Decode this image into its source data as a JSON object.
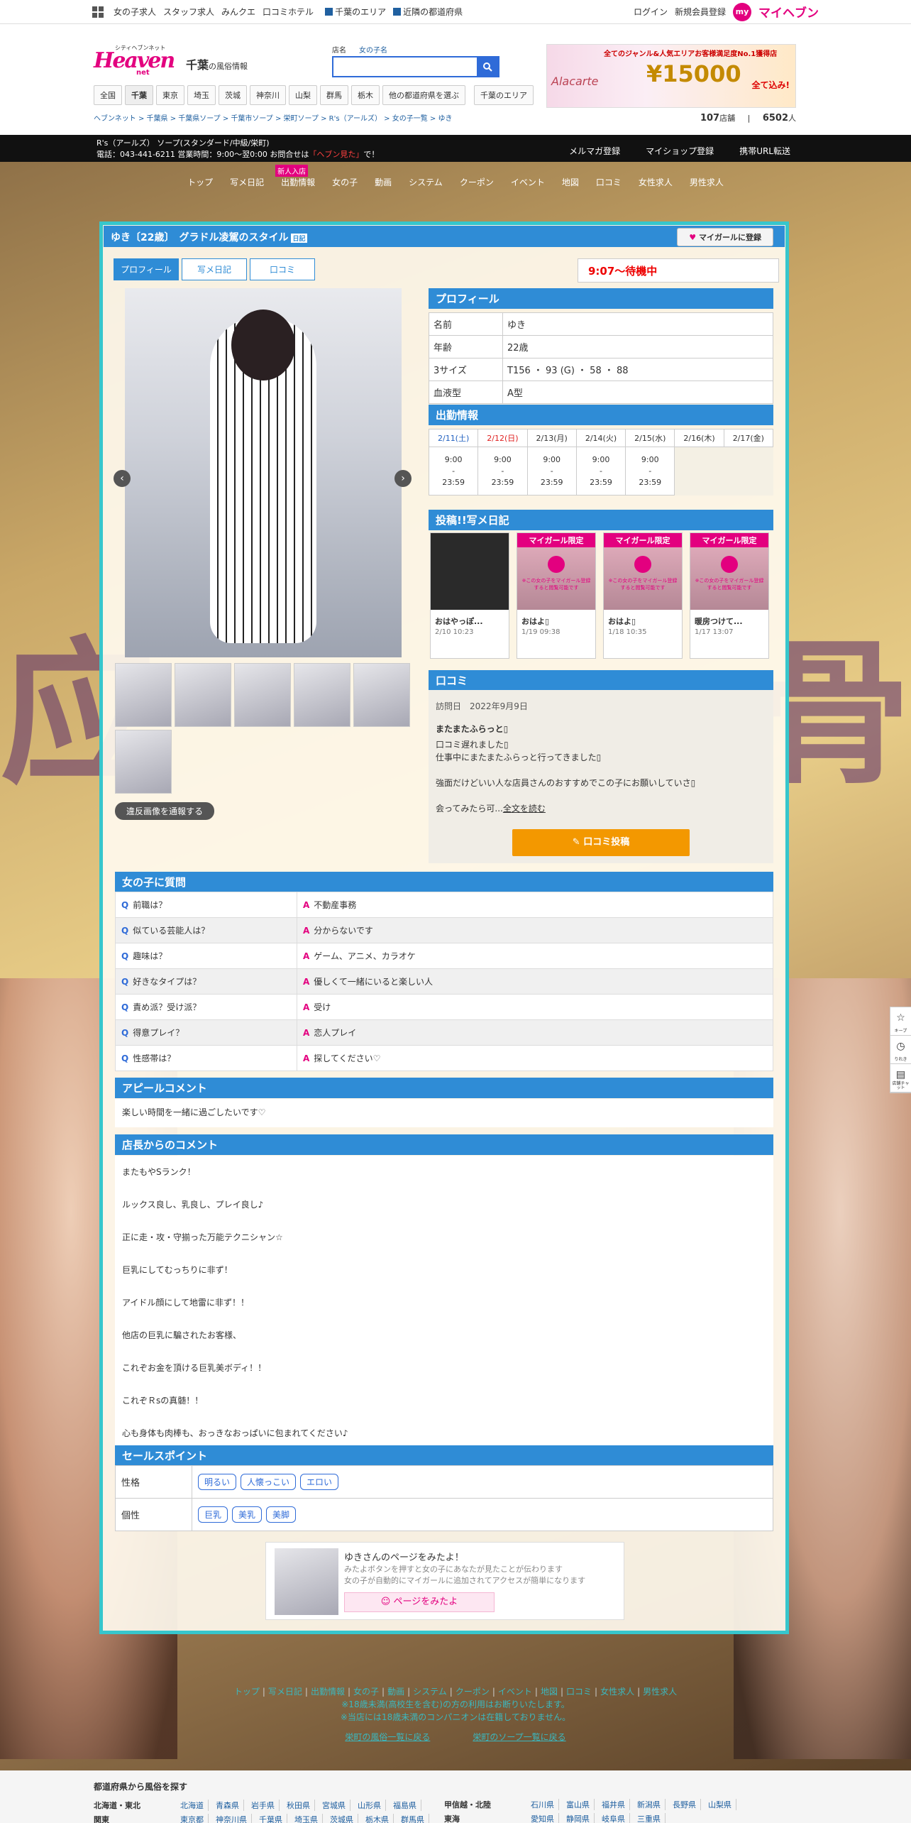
{
  "topbar": {
    "links": [
      "女の子求人",
      "スタッフ求人",
      "みんクエ",
      "口コミホテル"
    ],
    "area_link": "千葉のエリア",
    "near_link": "近隣の都道府県",
    "login": "ログイン",
    "register": "新規会員登録",
    "my_badge": "my",
    "myheaven": "マイヘブン"
  },
  "header": {
    "logo_small": "シティヘブンネット",
    "logo_main": "Heaven",
    "logo_net": "net",
    "area": "千葉",
    "area_suffix": "の風俗情報",
    "search_tabs": [
      "店名",
      "女の子名"
    ],
    "search_placeholder": "",
    "banner": {
      "line1": "全てのジャンル&人気エリアお客様満足度No.1獲得店",
      "brand": "Alacarte",
      "price": "¥15000",
      "tail": "全て込み!"
    }
  },
  "areanav": [
    "全国",
    "千葉",
    "東京",
    "埼玉",
    "茨城",
    "神奈川",
    "山梨",
    "群馬",
    "栃木",
    "他の都道府県を選ぶ",
    "千葉のエリア"
  ],
  "breadcrumb": "ヘブンネット > 千葉県 > 千葉県ソープ > 千葉市ソープ > 栄町ソープ > R's（アールズ） > 女の子一覧 > ゆき",
  "counts": {
    "shops": "107",
    "shops_unit": "店舗",
    "people": "6502",
    "people_unit": "人"
  },
  "shop": {
    "name": "R's（アールズ） ソープ(スタンダード/中級/栄町)",
    "info": "電話：043-441-6211 営業時間：9:00～翌0:00 お問合せは",
    "heaven_msg": "「ヘブン見た」",
    "info_tail": "で！",
    "links": [
      "メルマガ登録",
      "マイショップ登録",
      "携帯URL転送"
    ]
  },
  "shopnav": [
    "トップ",
    "写メ日記",
    "出勤情報",
    "女の子",
    "動画",
    "システム",
    "クーポン",
    "イベント",
    "地図",
    "口コミ",
    "女性求人",
    "男性求人"
  ],
  "shopnav_new": "新人入店",
  "bg_text": [
    "应",
    "骨"
  ],
  "profile_title": "ゆき〔22歳〕　グラドル凌駕のスタイル",
  "profile_badge": "日記",
  "fav_button": "マイガールに登録",
  "tabs": [
    "プロフィール",
    "写メ日記",
    "口コミ"
  ],
  "status": "9:07～待機中",
  "report": "違反画像を通報する",
  "profile": {
    "section": "プロフィール",
    "rows": [
      [
        "名前",
        "ゆき"
      ],
      [
        "年齢",
        "22歳"
      ],
      [
        "3サイズ",
        "T156 ・ 93 (G) ・ 58 ・ 88"
      ],
      [
        "血液型",
        "A型"
      ]
    ]
  },
  "schedule": {
    "section": "出勤情報",
    "days": [
      "2/11(土)",
      "2/12(日)",
      "2/13(月)",
      "2/14(火)",
      "2/15(水)",
      "2/16(木)",
      "2/17(金)"
    ],
    "shifts": [
      [
        "9:00",
        "-",
        "23:59"
      ],
      [
        "9:00",
        "-",
        "23:59"
      ],
      [
        "9:00",
        "-",
        "23:59"
      ],
      [
        "9:00",
        "-",
        "23:59"
      ],
      [
        "9:00",
        "-",
        "23:59"
      ]
    ]
  },
  "diary": {
    "section": "投稿!!写メ日記",
    "items": [
      {
        "title": "おはやっぽ...",
        "date": "2/10 10:23",
        "locked": false
      },
      {
        "title": "おはよ▯",
        "date": "1/19 09:38",
        "locked": true
      },
      {
        "title": "おはよ▯",
        "date": "1/18 10:35",
        "locked": true
      },
      {
        "title": "暖房つけて...",
        "date": "1/17 13:07",
        "locked": true
      }
    ],
    "lock_label": "マイガール限定",
    "lock_text": "※この女の子をマイガール登録すると閲覧可能です"
  },
  "review": {
    "section": "口コミ",
    "date_label": "訪問日",
    "date": "2022年9月9日",
    "title": "またまたふらっと▯",
    "lines": [
      "口コミ遅れました▯",
      "仕事中にまたまたふらっと行ってきました▯",
      "",
      "強面だけどいい人な店員さんのおすすめでこの子にお願いしていさ▯",
      "",
      "会ってみたら可..."
    ],
    "more": "全文を読む",
    "post_button": "口コミ投稿"
  },
  "qa": {
    "section": "女の子に質問",
    "q_mark": "Q",
    "a_mark": "A",
    "rows": [
      [
        "前職は？",
        "不動産事務"
      ],
      [
        "似ている芸能人は？",
        "分からないです"
      ],
      [
        "趣味は？",
        "ゲーム、アニメ、カラオケ"
      ],
      [
        "好きなタイプは？",
        "優しくて一緒にいると楽しい人"
      ],
      [
        "責め派？受け派？",
        "受け"
      ],
      [
        "得意プレイ？",
        "恋人プレイ"
      ],
      [
        "性感帯は？",
        "探してください♡"
      ]
    ]
  },
  "appeal": {
    "section": "アピールコメント",
    "text": "楽しい時間を一緒に過ごしたいです♡"
  },
  "manager": {
    "section": "店長からのコメント",
    "lines": [
      "またもやSランク！",
      "ルックス良し、乳良し、プレイ良し♪",
      "正に走・攻・守揃った万能テクニシャン☆",
      "巨乳にしてむっちりに非ず！",
      "アイドル顔にして地雷に非ず！！",
      "他店の巨乳に騙されたお客様、",
      "これぞお金を頂ける巨乳美ボディ！！",
      "これぞＲsの真髄！！",
      "心も身体も肉棒も、おっきなおっぱいに包まれてください♪"
    ]
  },
  "sales": {
    "section": "セールスポイント",
    "rows": [
      {
        "label": "性格",
        "tags": [
          "明るい",
          "人懐っこい",
          "エロい"
        ]
      },
      {
        "label": "個性",
        "tags": [
          "巨乳",
          "美乳",
          "美脚"
        ]
      }
    ]
  },
  "mitayo": {
    "title": "ゆきさんのページをみたよ！",
    "desc1": "みたよボタンを押すと女の子にあなたが見たことが伝わります",
    "desc2": "女の子が自動的にマイガールに追加されてアクセスが簡単になります",
    "button": "ページをみたよ"
  },
  "footer": {
    "links": [
      "トップ",
      "写メ日記",
      "出勤情報",
      "女の子",
      "動画",
      "システム",
      "クーポン",
      "イベント",
      "地図",
      "口コミ",
      "女性求人",
      "男性求人"
    ],
    "note1": "※18歳未満(高校生を含む)の方の利用はお断りいたします。",
    "note2": "※当店には18歳未満のコンパニオンは在籍しておりません。",
    "back1": "栄町の風俗一覧に戻る",
    "back2": "栄町のソープ一覧に戻る"
  },
  "side_icons": [
    {
      "icon": "☆",
      "label": "キープ"
    },
    {
      "icon": "◷",
      "label": "りれき"
    },
    {
      "icon": "▤",
      "label": "店舗チャット"
    }
  ],
  "prefs": {
    "heading": "都道府県から風俗を探す",
    "rows": [
      {
        "region": "北海道・東北",
        "items": [
          "北海道",
          "青森県",
          "岩手県",
          "秋田県",
          "宮城県",
          "山形県",
          "福島県"
        ]
      },
      {
        "region": "関東",
        "items": [
          "東京都",
          "神奈川県",
          "千葉県",
          "埼玉県",
          "茨城県",
          "栃木県",
          "群馬県"
        ]
      }
    ],
    "right_rows": [
      {
        "region": "甲信越・北陸",
        "items": [
          "石川県",
          "富山県",
          "福井県",
          "新潟県",
          "長野県",
          "山梨県"
        ]
      },
      {
        "region": "東海",
        "items": [
          "愛知県",
          "静岡県",
          "岐阜県",
          "三重県"
        ]
      }
    ]
  }
}
